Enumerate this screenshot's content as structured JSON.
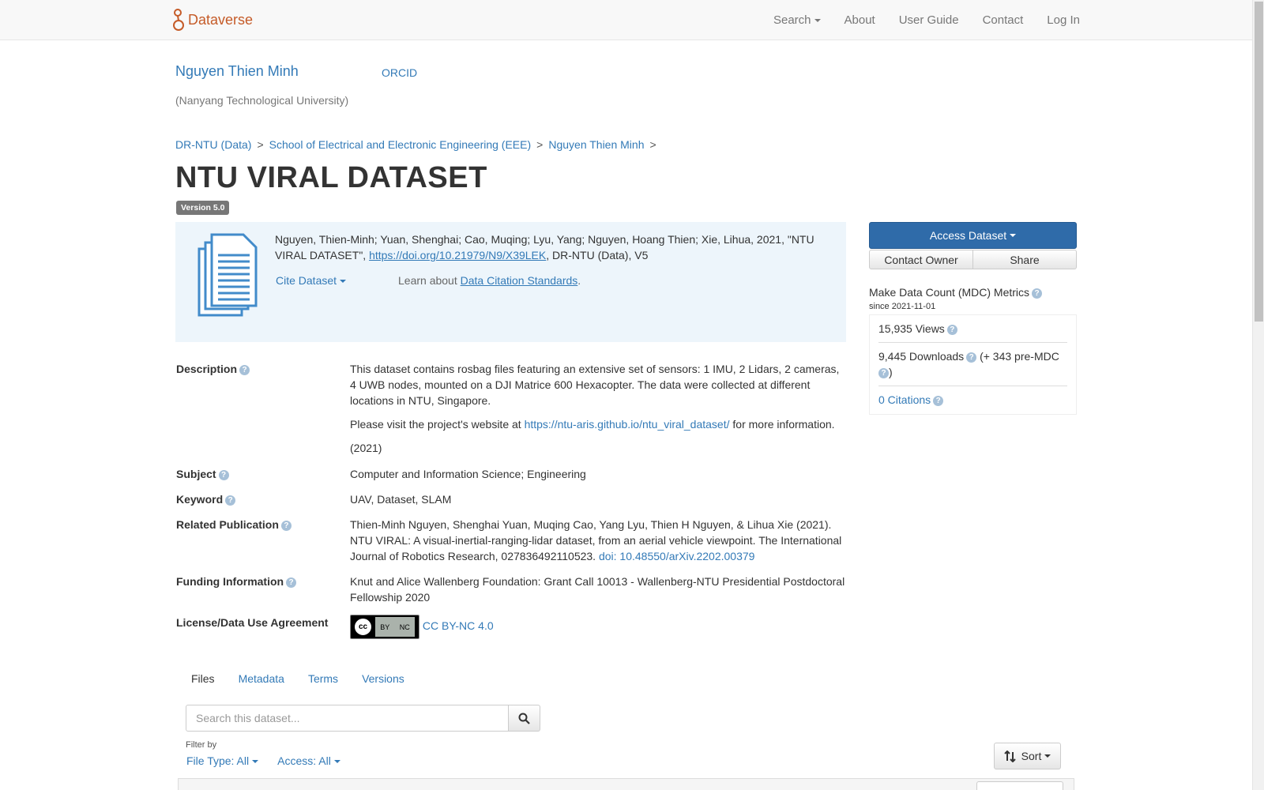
{
  "navbar": {
    "brand": "Dataverse",
    "items": [
      {
        "label": "Search",
        "dropdown": true
      },
      {
        "label": "About"
      },
      {
        "label": "User Guide"
      },
      {
        "label": "Contact"
      },
      {
        "label": "Log In"
      }
    ]
  },
  "author": {
    "name": "Nguyen Thien Minh",
    "orcid": "ORCID",
    "affiliation": "(Nanyang Technological University)"
  },
  "breadcrumb": [
    "DR-NTU (Data)",
    "School of Electrical and Electronic Engineering (EEE)",
    "Nguyen Thien Minh"
  ],
  "breadcrumb_sep": ">",
  "dataset": {
    "title": "NTU VIRAL DATASET",
    "version": "Version 5.0"
  },
  "citation": {
    "text_before": "Nguyen, Thien-Minh; Yuan, Shenghai; Cao, Muqing; Lyu, Yang; Nguyen, Hoang Thien; Xie, Lihua, 2021, \"NTU VIRAL DATASET\", ",
    "doi_link": "https://doi.org/10.21979/N9/X39LEK",
    "text_after": ", DR-NTU (Data), V5",
    "cite_label": "Cite Dataset",
    "learn_prefix": "Learn about ",
    "learn_link": "Data Citation Standards",
    "learn_suffix": "."
  },
  "actions": {
    "access": "Access Dataset",
    "contact": "Contact Owner",
    "share": "Share"
  },
  "mdc": {
    "title": "Make Data Count (MDC) Metrics",
    "since": "since 2021-11-01",
    "views": "15,935 Views",
    "downloads": "9,445 Downloads",
    "pre_mdc_open": "(+ 343 pre-MDC",
    "pre_mdc_close": ")",
    "citations": "0 Citations"
  },
  "metadata": {
    "description_label": "Description",
    "description_p1": "This dataset contains rosbag files featuring an extensive set of sensors: 1 IMU, 2 Lidars, 2 cameras, 4 UWB nodes, mounted on a DJI Matrice 600 Hexacopter. The data were collected at different locations in NTU, Singapore.",
    "description_p2_prefix": "Please visit the project's website at ",
    "description_p2_link": "https://ntu-aris.github.io/ntu_viral_dataset/",
    "description_p2_suffix": " for more information.",
    "description_year": "(2021)",
    "subject_label": "Subject",
    "subject": "Computer and Information Science; Engineering",
    "keyword_label": "Keyword",
    "keyword": "UAV, Dataset, SLAM",
    "related_label": "Related Publication",
    "related_text": "Thien-Minh Nguyen, Shenghai Yuan, Muqing Cao, Yang Lyu, Thien H Nguyen, & Lihua Xie (2021). NTU VIRAL: A visual-inertial-ranging-lidar dataset, from an aerial vehicle viewpoint. The International Journal of Robotics Research, 027836492110523.",
    "related_link": "doi: 10.48550/arXiv.2202.00379",
    "funding_label": "Funding Information",
    "funding": "Knut and Alice Wallenberg Foundation: Grant Call 10013 - Wallenberg-NTU Presidential Postdoctoral Fellowship 2020",
    "license_label": "License/Data Use Agreement",
    "license": "CC BY-NC 4.0",
    "license_badge_cc": "cc",
    "license_badge_by": "BY",
    "license_badge_nc": "NC"
  },
  "tabs": [
    {
      "label": "Files",
      "active": true
    },
    {
      "label": "Metadata"
    },
    {
      "label": "Terms"
    },
    {
      "label": "Versions"
    }
  ],
  "files": {
    "search_placeholder": "Search this dataset...",
    "filter_label": "Filter by",
    "file_type": "File Type: All",
    "access": "Access: All",
    "sort": "Sort"
  },
  "help_glyph": "?",
  "colors": {
    "brand": "#c55b28",
    "link": "#337ab7",
    "primary": "#2f6ba9",
    "cite_bg": "#edf5fb"
  }
}
